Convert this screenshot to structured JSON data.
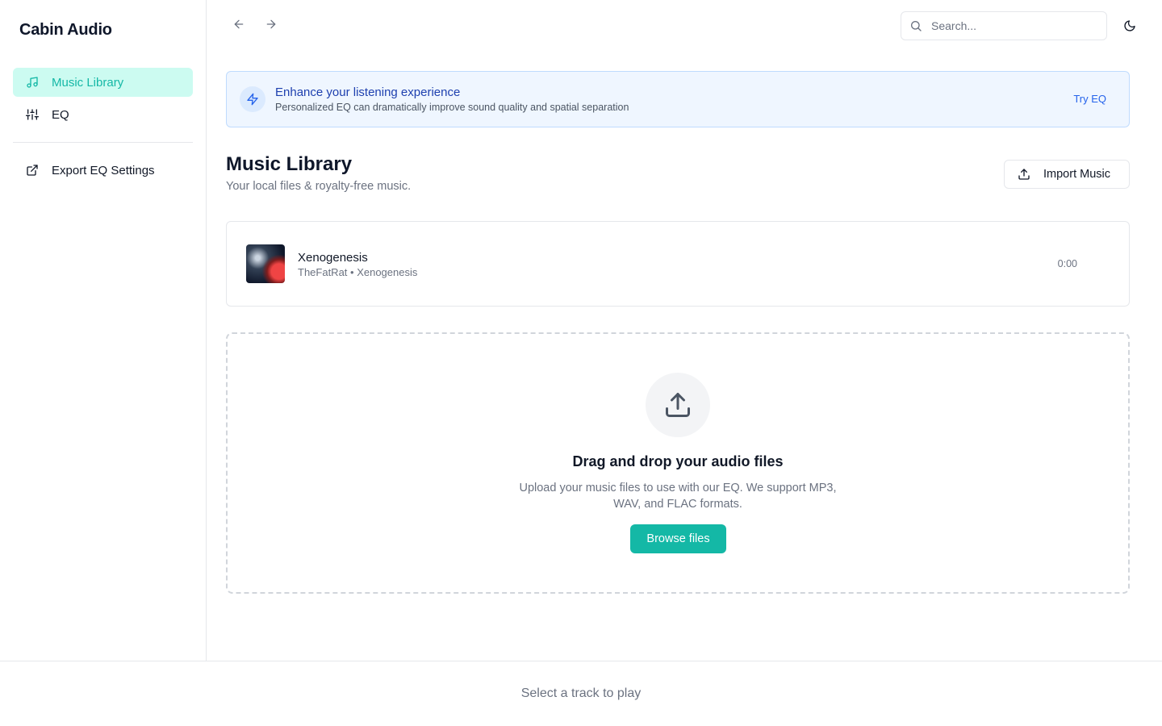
{
  "app": {
    "title": "Cabin Audio"
  },
  "sidebar": {
    "items": [
      {
        "label": "Music Library",
        "icon": "music-note-icon",
        "active": true
      },
      {
        "label": "EQ",
        "icon": "sliders-icon",
        "active": false
      }
    ],
    "secondary": [
      {
        "label": "Export EQ Settings",
        "icon": "external-link-icon"
      }
    ]
  },
  "topbar": {
    "back_icon": "arrow-left-icon",
    "forward_icon": "arrow-right-icon",
    "search_placeholder": "Search...",
    "search_value": "",
    "theme_icon": "moon-icon"
  },
  "banner": {
    "icon": "lightning-icon",
    "title": "Enhance your listening experience",
    "subtitle": "Personalized EQ can dramatically improve sound quality and spatial separation",
    "cta": "Try EQ"
  },
  "main": {
    "title": "Music Library",
    "subtitle": "Your local files & royalty-free music.",
    "import_button": "Import Music",
    "import_icon": "upload-icon"
  },
  "tracks": [
    {
      "title": "Xenogenesis",
      "meta": "TheFatRat • Xenogenesis",
      "duration": "0:00"
    }
  ],
  "dropzone": {
    "icon": "upload-icon",
    "title": "Drag and drop your audio files",
    "description": "Upload your music files to use with our EQ. We support MP3, WAV, and FLAC formats.",
    "button": "Browse files"
  },
  "player": {
    "status": "Select a track to play"
  },
  "colors": {
    "accent": "#14b8a6",
    "accent_bg": "#ccfbf1",
    "banner_bg": "#eff6ff",
    "banner_text": "#1e40af",
    "link": "#2563eb"
  }
}
